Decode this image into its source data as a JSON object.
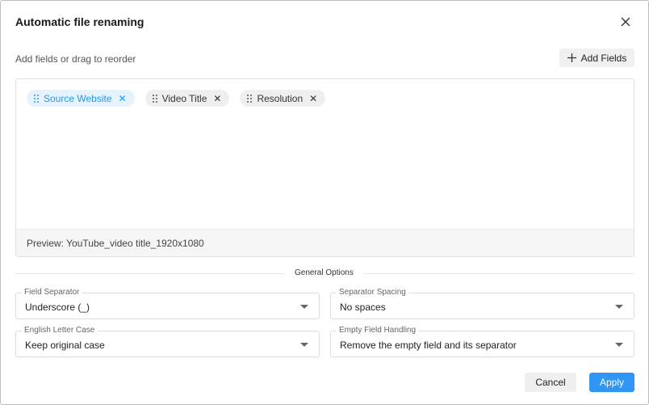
{
  "dialog": {
    "title": "Automatic file renaming",
    "close_icon": "close-icon",
    "subtitle": "Add fields or drag to reorder",
    "add_fields_label": "Add Fields",
    "add_icon": "plus-icon"
  },
  "fields": {
    "chips": [
      {
        "label": "Source Website",
        "remove": "✕",
        "active": true
      },
      {
        "label": "Video Title",
        "remove": "✕",
        "active": false
      },
      {
        "label": "Resolution",
        "remove": "✕",
        "active": false
      }
    ],
    "preview": "Preview: YouTube_video title_1920x1080"
  },
  "options": {
    "section_title": "General Options",
    "field_separator": {
      "label": "Field Separator",
      "value": "Underscore (_)"
    },
    "separator_spacing": {
      "label": "Separator Spacing",
      "value": "No spaces"
    },
    "letter_case": {
      "label": "English Letter Case",
      "value": "Keep original case"
    },
    "empty_field": {
      "label": "Empty Field Handling",
      "value": "Remove the empty field and its separator"
    }
  },
  "footer": {
    "cancel_label": "Cancel",
    "apply_label": "Apply"
  },
  "colors": {
    "accent": "#2f96f3",
    "chip_active_bg": "#e4f3fd",
    "chip_active_text": "#2b97e3"
  }
}
